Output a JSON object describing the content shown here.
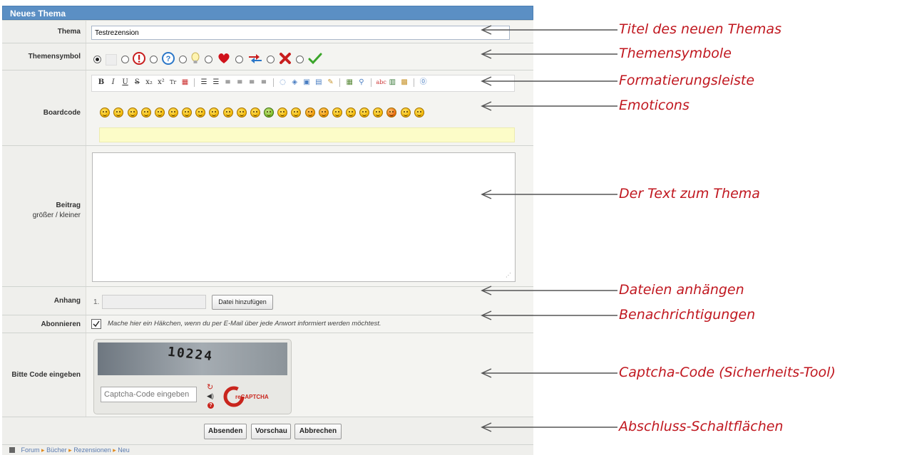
{
  "form": {
    "title": "Neues Thema",
    "thema": {
      "label": "Thema",
      "value": "Testrezension"
    },
    "themensymbol": {
      "label": "Themensymbol",
      "selected_index": 0
    },
    "boardcode": {
      "label": "Boardcode"
    },
    "beitrag": {
      "label": "Beitrag",
      "sub_larger": "größer",
      "sub_sep": " / ",
      "sub_smaller": "kleiner",
      "value": ""
    },
    "anhang": {
      "label": "Anhang",
      "index": "1.",
      "button": "Datei hinzufügen"
    },
    "abonnieren": {
      "label": "Abonnieren",
      "checked": true,
      "text": "Mache hier ein Häkchen, wenn du per E-Mail über jede Anwort informiert werden möchtest."
    },
    "captcha": {
      "label": "Bitte Code eingeben",
      "image_text": "10224",
      "placeholder": "Captcha-Code eingeben",
      "brand": "reCAPTCHA"
    },
    "buttons": {
      "submit": "Absenden",
      "preview": "Vorschau",
      "cancel": "Abbrechen"
    }
  },
  "breadcrumb": [
    "Forum",
    "Bücher",
    "Rezensionen",
    "Neu"
  ],
  "annotations": {
    "title": "Titel des neuen Themas",
    "symbols": "Themensymbole",
    "toolbar": "Formatierungsleiste",
    "emoticons": "Emoticons",
    "text": "Der Text zum Thema",
    "attach": "Dateien anhängen",
    "notify": "Benachrichtigungen",
    "captcha": "Captcha-Code (Sicherheits-Tool)",
    "buttons": "Abschluss-Schaltflächen"
  },
  "colors": {
    "header": "#5b8fc4",
    "annotation": "#c0171f",
    "label_bg": "#efefec"
  }
}
